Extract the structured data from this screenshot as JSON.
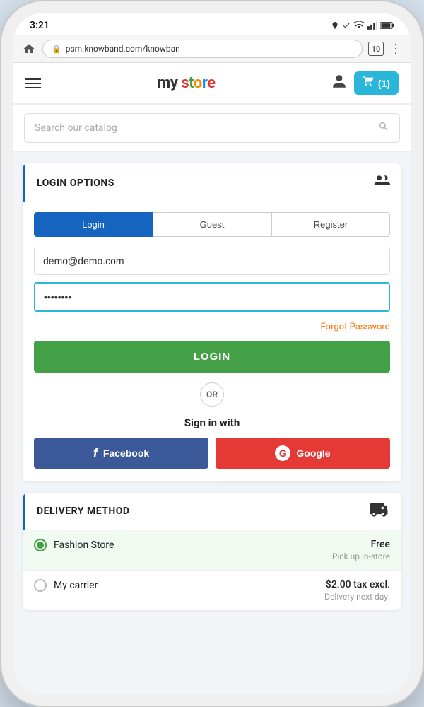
{
  "status_bar": {
    "time": "3:21",
    "url": "psm.knowband.com/knowban",
    "tab_count": "10"
  },
  "header": {
    "logo_my": "my ",
    "logo_store": "store",
    "cart_label": "(1)"
  },
  "search": {
    "placeholder": "Search our catalog"
  },
  "login_section": {
    "title": "LOGIN OPTIONS",
    "tabs": {
      "login": "Login",
      "guest": "Guest",
      "register": "Register"
    },
    "email_value": "demo@demo.com",
    "password_value": "••••••••",
    "forgot_password": "Forgot Password",
    "login_button": "LOGIN",
    "or_text": "OR",
    "sign_in_with": "Sign in with",
    "facebook_label": "Facebook",
    "google_label": "Google"
  },
  "delivery_section": {
    "title": "DELIVERY METHOD",
    "options": [
      {
        "name": "Fashion Store",
        "price": "Free",
        "note": "Pick up in-store",
        "selected": true
      },
      {
        "name": "My carrier",
        "price": "$2.00 tax excl.",
        "note": "Delivery next day!",
        "selected": false
      }
    ]
  }
}
